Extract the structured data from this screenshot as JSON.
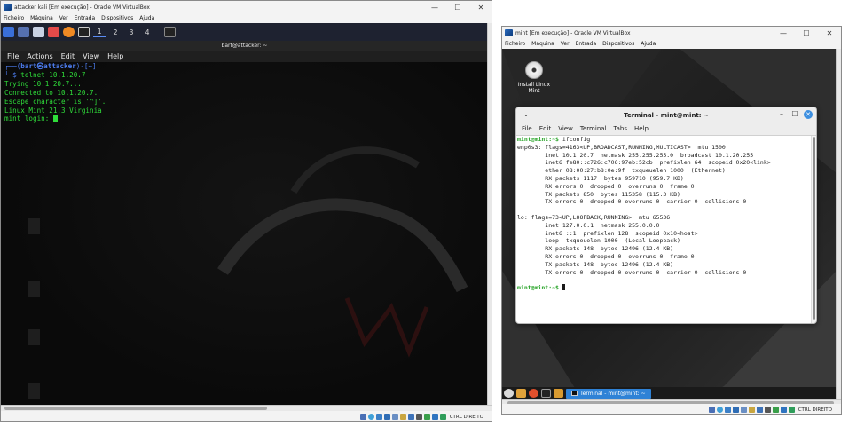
{
  "left_window": {
    "title": "attacker kali [Em execução] - Oracle VM VirtualBox",
    "menu": [
      "Ficheiro",
      "Máquina",
      "Ver",
      "Entrada",
      "Dispositivos",
      "Ajuda"
    ],
    "controls": {
      "minimize": "—",
      "maximize": "☐",
      "close": "✕"
    },
    "kali_panel": {
      "workspaces": [
        "1",
        "2",
        "3",
        "4"
      ],
      "active_workspace": "1"
    },
    "terminal": {
      "header_title": "bart@attacker: ~",
      "menu": [
        "File",
        "Actions",
        "Edit",
        "View",
        "Help"
      ],
      "prompt_line1_prefix": "┌──(",
      "prompt_user": "bart㉿attacker",
      "prompt_line1_suffix": ")-[~]",
      "prompt_line2_prefix": "└─$ ",
      "command": "telnet 10.1.20.7",
      "output": [
        "Trying 10.1.20.7...",
        "Connected to 10.1.20.7.",
        "Escape character is '^]'.",
        "Linux Mint 21.3 Virginia",
        "mint login: "
      ]
    },
    "status_text": "CTRL DIREITO"
  },
  "right_window": {
    "title": "mint [Em execução] - Oracle VM VirtualBox",
    "menu": [
      "Ficheiro",
      "Máquina",
      "Ver",
      "Entrada",
      "Dispositivos",
      "Ajuda"
    ],
    "controls": {
      "minimize": "—",
      "maximize": "☐",
      "close": "✕"
    },
    "desktop_icon": {
      "label": "Install Linux Mint"
    },
    "terminal": {
      "title": "Terminal - mint@mint: ~",
      "menu": [
        "File",
        "Edit",
        "View",
        "Terminal",
        "Tabs",
        "Help"
      ],
      "prompt": "mint@mint:~$",
      "command": " ifconfig",
      "output": [
        "enp0s3: flags=4163<UP,BROADCAST,RUNNING,MULTICAST>  mtu 1500",
        "        inet 10.1.20.7  netmask 255.255.255.0  broadcast 10.1.20.255",
        "        inet6 fe80::c726:c706:97eb:52cb  prefixlen 64  scopeid 0x20<link>",
        "        ether 08:00:27:b8:0e:9f  txqueuelen 1000  (Ethernet)",
        "        RX packets 1117  bytes 959710 (959.7 KB)",
        "        RX errors 0  dropped 0  overruns 0  frame 0",
        "        TX packets 850  bytes 115358 (115.3 KB)",
        "        TX errors 0  dropped 0 overruns 0  carrier 0  collisions 0",
        "",
        "lo: flags=73<UP,LOOPBACK,RUNNING>  mtu 65536",
        "        inet 127.0.0.1  netmask 255.0.0.0",
        "        inet6 ::1  prefixlen 128  scopeid 0x10<host>",
        "        loop  txqueuelen 1000  (Local Loopback)",
        "        RX packets 148  bytes 12496 (12.4 KB)",
        "        RX errors 0  dropped 0  overruns 0  frame 0",
        "        TX packets 148  bytes 12496 (12.4 KB)",
        "        TX errors 0  dropped 0 overruns 0  carrier 0  collisions 0",
        ""
      ],
      "final_prompt": "mint@mint:~$"
    },
    "taskbar_item": "Terminal - mint@mint: ~",
    "status_text": "CTRL DIREITO"
  }
}
